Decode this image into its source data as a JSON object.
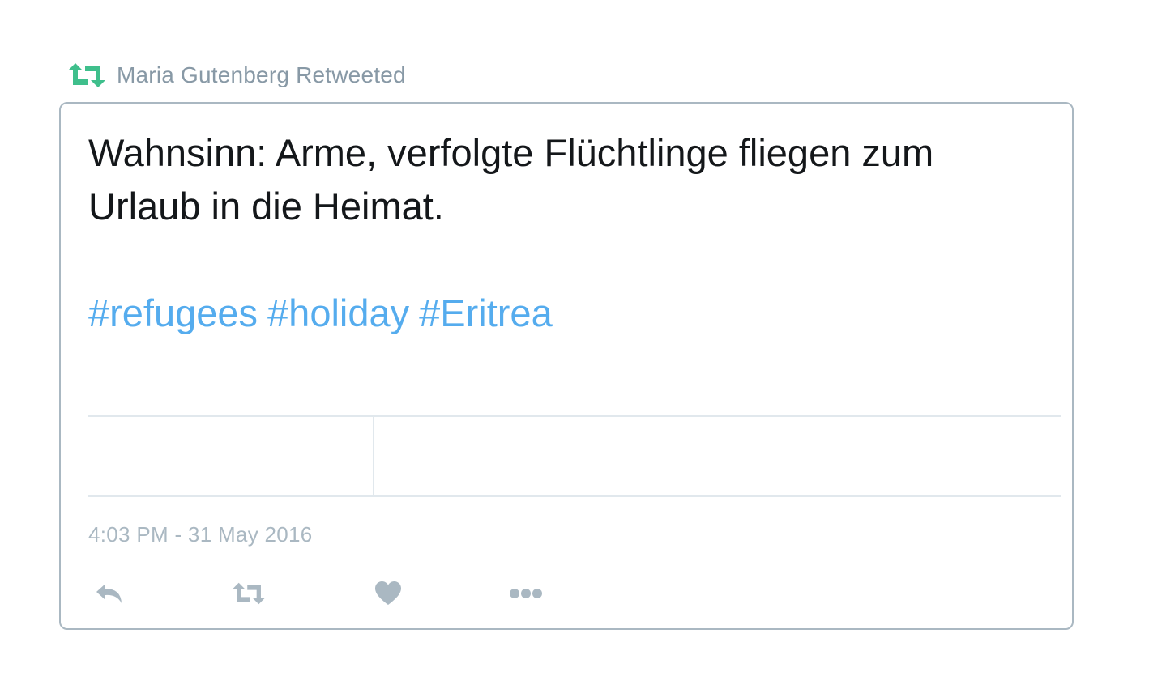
{
  "retweet_header": {
    "label": "Maria Gutenberg Retweeted",
    "icon": "retweet-icon",
    "color": "#3fbf8c"
  },
  "tweet": {
    "text": "Wahnsinn: Arme, verfolgte Flüchtlinge fliegen zum Urlaub in die Heimat.",
    "hashtags": [
      "#refugees",
      "#holiday",
      "#Eritrea"
    ],
    "hashtag_color": "#55acee",
    "timestamp": "4:03 PM - 31 May 2016"
  },
  "actions": [
    {
      "icon": "reply-icon"
    },
    {
      "icon": "retweet-icon"
    },
    {
      "icon": "heart-icon"
    },
    {
      "icon": "more-icon"
    }
  ],
  "colors": {
    "text": "#14171a",
    "muted": "#8899a6",
    "border": "#aab8c2",
    "action_icon": "#aab8c2"
  }
}
